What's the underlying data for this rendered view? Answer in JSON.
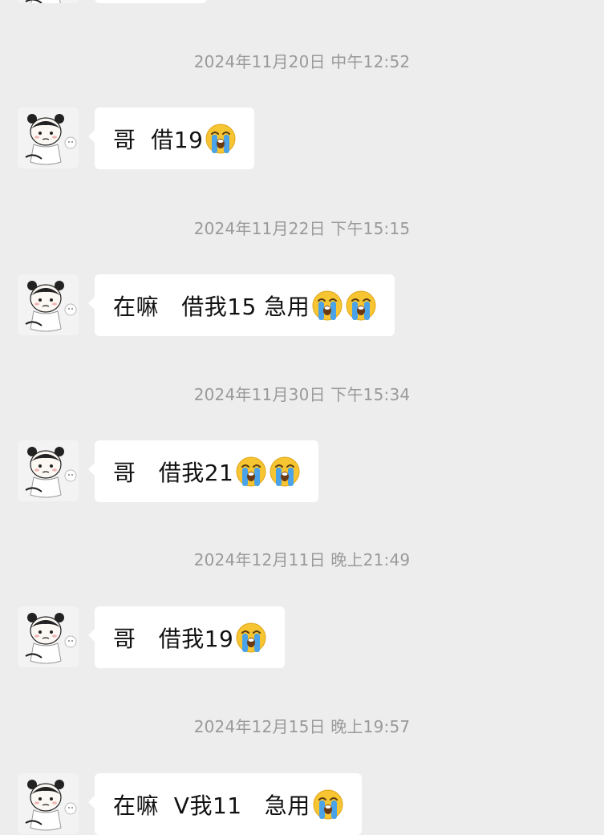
{
  "messages": [
    {
      "timestamp": "2024年11月20日 中午12:52",
      "text": "哥  借19",
      "cry_count": 1
    },
    {
      "timestamp": "2024年11月22日 下午15:15",
      "text": "在嘛   借我15 急用",
      "cry_count": 2
    },
    {
      "timestamp": "2024年11月30日 下午15:34",
      "text": "哥   借我21",
      "cry_count": 2
    },
    {
      "timestamp": "2024年12月11日 晚上21:49",
      "text": "哥   借我19",
      "cry_count": 1
    },
    {
      "timestamp": "2024年12月15日 晚上19:57",
      "text": "在嘛  V我11   急用",
      "cry_count": 1
    }
  ],
  "colors": {
    "background": "#ededed",
    "bubble": "#ffffff",
    "timestamp": "#9a9a9a"
  },
  "icons": {
    "emoji": "loudly-crying-face-icon",
    "avatar": "cartoon-girl-avatar"
  }
}
